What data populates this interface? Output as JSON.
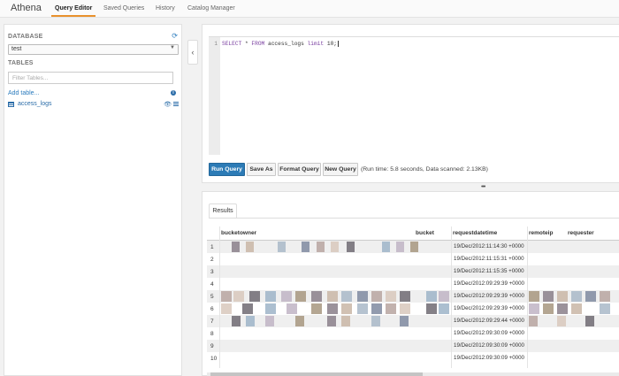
{
  "app": {
    "brand": "Athena",
    "nav_tabs": [
      "Query Editor",
      "Saved Queries",
      "History",
      "Catalog Manager"
    ],
    "active_tab": "Query Editor",
    "accent_color": "#e8912d"
  },
  "sidebar": {
    "database_label": "DATABASE",
    "database_value": "test",
    "tables_label": "TABLES",
    "filter_placeholder": "Filter Tables...",
    "add_table": "Add table...",
    "tables": [
      {
        "name": "access_logs"
      }
    ]
  },
  "editor": {
    "line_number": "1",
    "query_keyword_1": "SELECT",
    "query_mid": " * ",
    "query_keyword_2": "FROM",
    "query_table": " access_logs ",
    "query_keyword_3": "limit",
    "query_tail": " 10;",
    "buttons": {
      "run": "Run Query",
      "save_as": "Save As",
      "format": "Format Query",
      "new": "New Query"
    },
    "run_info": "(Run time: 5.8 seconds, Data scanned: 2.13KB)",
    "primary_color": "#2c7bb6"
  },
  "results": {
    "tab_label": "Results",
    "columns": [
      "bucketowner",
      "bucket",
      "requestdatetime",
      "remoteip",
      "requester"
    ],
    "rows": [
      {
        "n": "1",
        "requestdatetime": "19/Dec/2012:11:14:30 +0000"
      },
      {
        "n": "2",
        "requestdatetime": "19/Dec/2012:11:15:31 +0000"
      },
      {
        "n": "3",
        "requestdatetime": "19/Dec/2012:11:15:35 +0000"
      },
      {
        "n": "4",
        "requestdatetime": "19/Dec/2012:09:29:39 +0000"
      },
      {
        "n": "5",
        "requestdatetime": "19/Dec/2012:09:29:39 +0000"
      },
      {
        "n": "6",
        "requestdatetime": "19/Dec/2012:09:29:39 +0000"
      },
      {
        "n": "7",
        "requestdatetime": "19/Dec/2012:09:29:44 +0000"
      },
      {
        "n": "8",
        "requestdatetime": "19/Dec/2012:09:30:09 +0000"
      },
      {
        "n": "9",
        "requestdatetime": "19/Dec/2012:09:30:09 +0000"
      },
      {
        "n": "10",
        "requestdatetime": "19/Dec/2012:09:30:09 +0000"
      }
    ],
    "redaction_palette": [
      "#8a7f8a",
      "#c9b6a6",
      "#a9b8c8",
      "#7f8aa0",
      "#b7a4a0",
      "#d8c8bc",
      "#6f6a72",
      "#9eb4c8",
      "#c0b4c4",
      "#a7967f"
    ]
  }
}
